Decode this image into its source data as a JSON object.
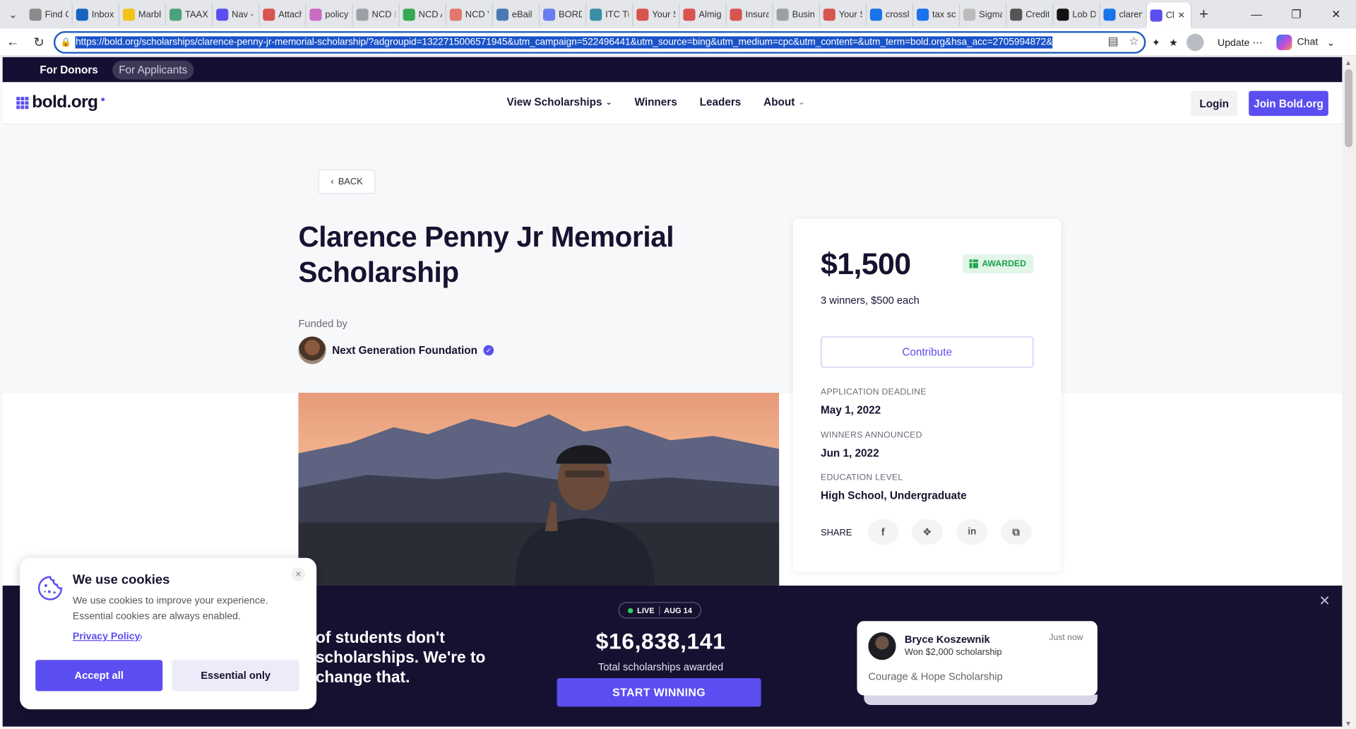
{
  "browser": {
    "tabs": [
      {
        "label": "Find C",
        "color": "#8a8a8a"
      },
      {
        "label": "Inbox",
        "color": "#1565c0"
      },
      {
        "label": "Marbl",
        "color": "#f2c318"
      },
      {
        "label": "TAAX",
        "color": "#4aa37a"
      },
      {
        "label": "Nav -",
        "color": "#5b4ef0"
      },
      {
        "label": "Attach",
        "color": "#d9534f"
      },
      {
        "label": "policy",
        "color": "#c86bc4"
      },
      {
        "label": "NCD I",
        "color": "#9aa0a6"
      },
      {
        "label": "NCD A",
        "color": "#34a853"
      },
      {
        "label": "NCD V",
        "color": "#e2786f"
      },
      {
        "label": "eBail",
        "color": "#4a7ab5"
      },
      {
        "label": "BORD",
        "color": "#6b7cf0"
      },
      {
        "label": "ITC Tu",
        "color": "#3b8ea5"
      },
      {
        "label": "Your S",
        "color": "#d9534f"
      },
      {
        "label": "Almig",
        "color": "#d9534f"
      },
      {
        "label": "Insura",
        "color": "#d9534f"
      },
      {
        "label": "Busin",
        "color": "#9aa0a6"
      },
      {
        "label": "Your S",
        "color": "#d9534f"
      },
      {
        "label": "crossl",
        "color": "#1a73e8"
      },
      {
        "label": "tax sc",
        "color": "#1a73e8"
      },
      {
        "label": "Sigma",
        "color": "#bbbbbb"
      },
      {
        "label": "Credit",
        "color": "#555555"
      },
      {
        "label": "Lob D",
        "color": "#111111"
      },
      {
        "label": "claren",
        "color": "#1a73e8"
      },
      {
        "label": "Cl",
        "color": "#5b4ef0"
      }
    ],
    "url": "https://bold.org/scholarships/clarence-penny-jr-memorial-scholarship/?adgroupid=1322715006571945&utm_campaign=522496441&utm_source=bing&utm_medium=cpc&utm_content=&utm_term=bold.org&hsa_acc=2705994872&",
    "update_label": "Update",
    "chat_label": "Chat"
  },
  "site": {
    "top_links": [
      "For Donors",
      "For Applicants"
    ],
    "logo": "bold.org",
    "nav": {
      "view_scholarships": "View Scholarships",
      "winners": "Winners",
      "leaders": "Leaders",
      "about": "About"
    },
    "login": "Login",
    "join": "Join Bold.org"
  },
  "scholarship": {
    "back": "BACK",
    "title": "Clarence Penny Jr Memorial Scholarship",
    "funded_by_label": "Funded by",
    "funder": "Next Generation Foundation",
    "amount": "$1,500",
    "status": "AWARDED",
    "winners_text": "3 winners, $500 each",
    "contribute": "Contribute",
    "deadline_label": "APPLICATION DEADLINE",
    "deadline": "May 1, 2022",
    "announced_label": "WINNERS ANNOUNCED",
    "announced": "Jun 1, 2022",
    "education_label": "EDUCATION LEVEL",
    "education": "High School, Undergraduate",
    "share_label": "SHARE"
  },
  "banner": {
    "slogan": "of students don't scholarships. We're to change that.",
    "live": "LIVE",
    "date": "AUG 14",
    "total": "$16,838,141",
    "total_label": "Total scholarships awarded",
    "cta": "START WINNING",
    "notification": {
      "name": "Bryce Koszewnik",
      "sub": "Won $2,000 scholarship",
      "time": "Just now",
      "scholarship": "Courage & Hope Scholarship"
    }
  },
  "cookie": {
    "title": "We use cookies",
    "body": "We use cookies to improve your experience. Essential cookies are always enabled.",
    "privacy": "Privacy Policy",
    "accept": "Accept all",
    "essential": "Essential only"
  },
  "colors": {
    "brand": "#5b4ef0",
    "dark": "#171131",
    "awarded": "#18a34a"
  }
}
